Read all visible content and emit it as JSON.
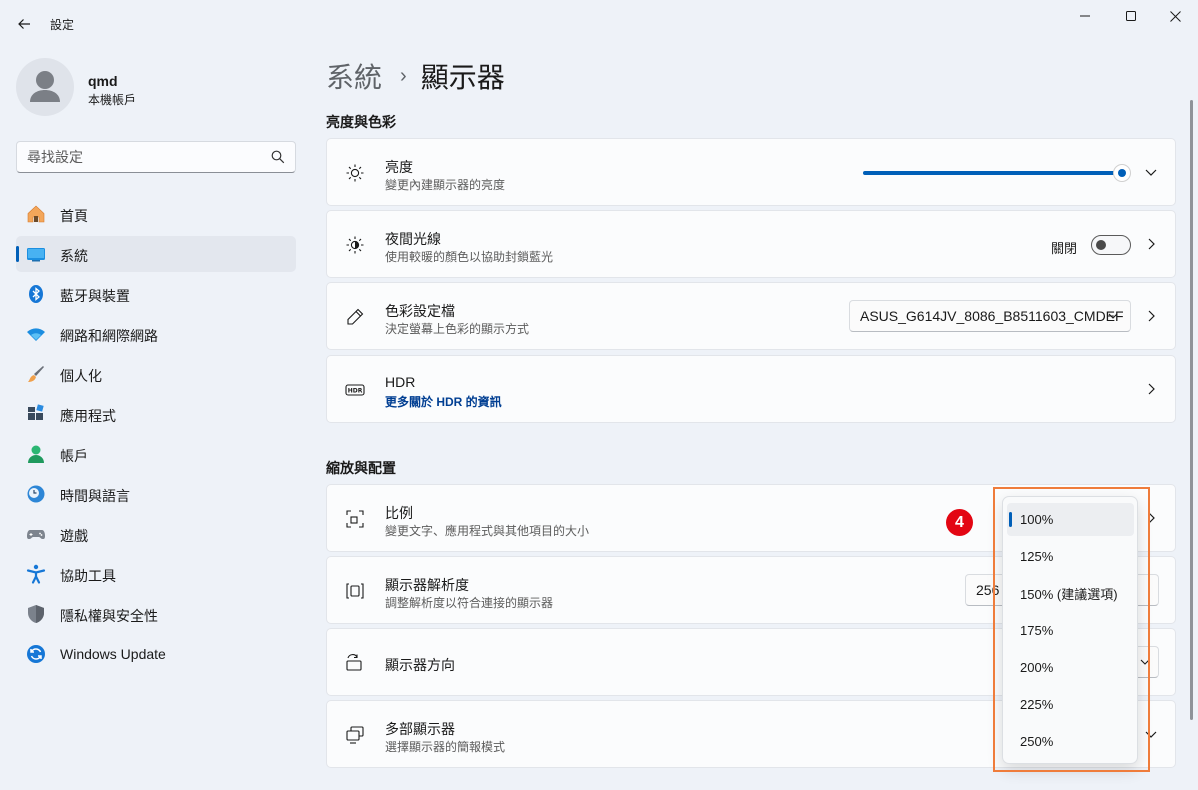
{
  "window": {
    "title": "設定"
  },
  "user": {
    "name": "qmd",
    "account": "本機帳戶"
  },
  "search": {
    "placeholder": "尋找設定"
  },
  "nav": [
    {
      "label": "首頁",
      "icon": "home-icon"
    },
    {
      "label": "系統",
      "icon": "system-icon",
      "active": true
    },
    {
      "label": "藍牙與裝置",
      "icon": "bluetooth-icon"
    },
    {
      "label": "網路和網際網路",
      "icon": "wifi-icon"
    },
    {
      "label": "個人化",
      "icon": "brush-icon"
    },
    {
      "label": "應用程式",
      "icon": "apps-icon"
    },
    {
      "label": "帳戶",
      "icon": "account-icon"
    },
    {
      "label": "時間與語言",
      "icon": "clock-globe-icon"
    },
    {
      "label": "遊戲",
      "icon": "gamepad-icon"
    },
    {
      "label": "協助工具",
      "icon": "accessibility-icon"
    },
    {
      "label": "隱私權與安全性",
      "icon": "shield-icon"
    },
    {
      "label": "Windows Update",
      "icon": "update-icon"
    }
  ],
  "breadcrumb": {
    "parent": "系統",
    "separator": "›",
    "current": "顯示器"
  },
  "sections": {
    "brightness_color": "亮度與色彩",
    "scale_layout": "縮放與配置"
  },
  "cards": {
    "brightness": {
      "title": "亮度",
      "subtitle": "變更內建顯示器的亮度",
      "value_percent": 100
    },
    "night_light": {
      "title": "夜間光線",
      "subtitle": "使用較暖的顏色以協助封鎖藍光",
      "toggle_label": "關閉",
      "toggle_on": false
    },
    "color_profile": {
      "title": "色彩設定檔",
      "subtitle": "決定螢幕上色彩的顯示方式",
      "selected": "ASUS_G614JV_8086_B8511603_CMDEF"
    },
    "hdr": {
      "title": "HDR",
      "subtitle": "更多關於 HDR 的資訊"
    },
    "scale": {
      "title": "比例",
      "subtitle": "變更文字、應用程式與其他項目的大小"
    },
    "resolution": {
      "title": "顯示器解析度",
      "subtitle": "調整解析度以符合連接的顯示器",
      "selected_partial": "256"
    },
    "orientation": {
      "title": "顯示器方向"
    },
    "multi_display": {
      "title": "多部顯示器",
      "subtitle": "選擇顯示器的簡報模式"
    }
  },
  "scale_dropdown": {
    "options": [
      "100%",
      "125%",
      "150% (建議選項)",
      "175%",
      "200%",
      "225%",
      "250%"
    ],
    "selected_index": 0
  },
  "annotation": {
    "step": "4"
  },
  "colors": {
    "accent": "#005fb8",
    "highlight_box": "#ef7c3b",
    "badge": "#e30613"
  }
}
